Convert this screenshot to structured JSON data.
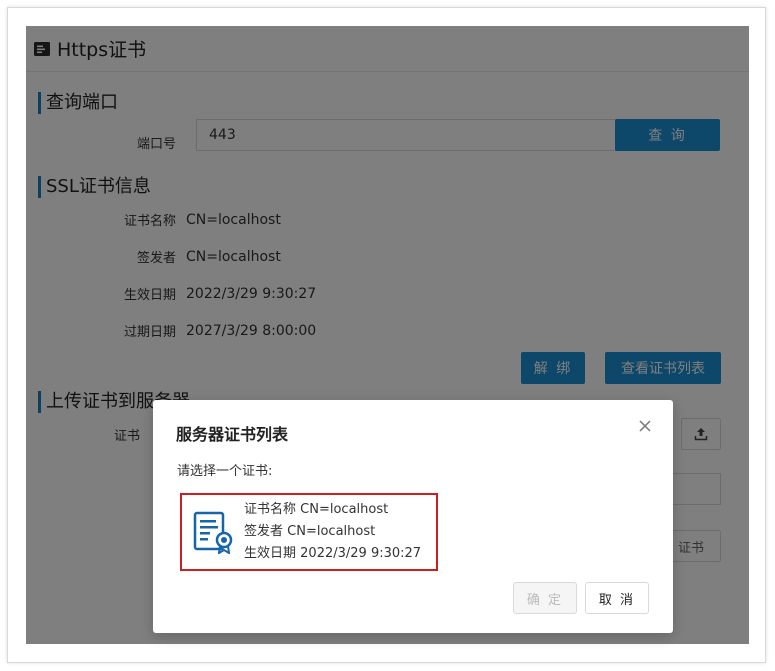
{
  "panel": {
    "title": "Https证书",
    "header_icon": "certificate-card-icon"
  },
  "query_section": {
    "title": "查询端口",
    "port_label": "端口号",
    "port_value": "443",
    "query_button": "查 询"
  },
  "ssl_section": {
    "title": "SSL证书信息",
    "fields": [
      {
        "label": "证书名称",
        "value": "CN=localhost"
      },
      {
        "label": "签发者",
        "value": "CN=localhost"
      },
      {
        "label": "生效日期",
        "value": "2022/3/29 9:30:27"
      },
      {
        "label": "过期日期",
        "value": "2027/3/29 8:00:00"
      }
    ],
    "unbind_button": "解 绑",
    "view_list_button": "查看证书列表"
  },
  "upload_section": {
    "title": "上传证书到服务器",
    "cert_label": "证书",
    "upload_icon": "upload-icon",
    "upload_button_partial": "证书"
  },
  "modal": {
    "title": "服务器证书列表",
    "prompt": "请选择一个证书:",
    "close_icon": "close-icon",
    "certificate": {
      "icon": "certificate-document-icon",
      "name_label": "证书名称",
      "name_value": "CN=localhost",
      "issuer_label": "签发者",
      "issuer_value": "CN=localhost",
      "valid_from_label": "生效日期",
      "valid_from_value": "2022/3/29 9:30:27"
    },
    "ok_button": "确 定",
    "cancel_button": "取 消"
  },
  "colors": {
    "primary": "#1a8ed3",
    "accent_border": "#1a7fbf",
    "highlight_red": "#cc1f1f",
    "overlay": "rgba(0,0,0,0.5)"
  }
}
